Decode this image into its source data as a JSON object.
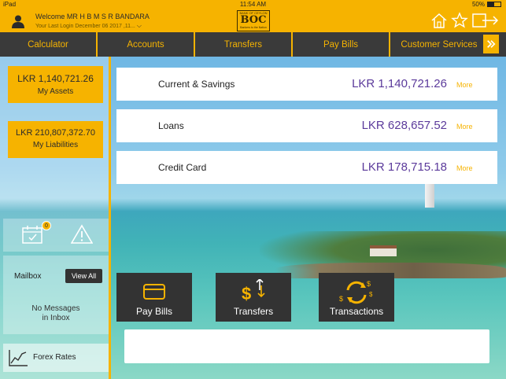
{
  "status_bar": {
    "device": "iPad",
    "time": "11:54 AM",
    "battery": "50%"
  },
  "header": {
    "welcome": "Welcome MR H B M S R BANDARA",
    "last_login": "Your Last Login December 06 2017 ,11...",
    "logo": {
      "top_text": "BANK OF CEYLON",
      "mark": "BOC",
      "tagline": "Bankers to the Nation"
    },
    "icons": [
      "home-icon",
      "favorite-icon",
      "logout-icon"
    ]
  },
  "nav": {
    "items": [
      {
        "label": "Calculator"
      },
      {
        "label": "Accounts"
      },
      {
        "label": "Transfers"
      },
      {
        "label": "Pay Bills"
      },
      {
        "label": "Customer Services"
      }
    ]
  },
  "sidebar": {
    "assets": {
      "value": "LKR 1,140,721.26",
      "label": "My Assets"
    },
    "liabilities": {
      "value": "LKR 210,807,372.70",
      "label": "My Liabilities"
    },
    "calendar_badge": "0",
    "mailbox": {
      "title": "Mailbox",
      "view_all": "View All",
      "empty_line1": "No Messages",
      "empty_line2": "in Inbox"
    },
    "forex": "Forex Rates"
  },
  "accounts": [
    {
      "name": "Current & Savings",
      "amount": "LKR 1,140,721.26",
      "more": "More"
    },
    {
      "name": "Loans",
      "amount": "LKR 628,657.52",
      "more": "More"
    },
    {
      "name": "Credit Card",
      "amount": "LKR 178,715.18",
      "more": "More"
    }
  ],
  "quick_actions": [
    {
      "label": "Pay Bills",
      "icon": "credit-card-icon"
    },
    {
      "label": "Transfers",
      "icon": "transfer-dollar-icon"
    },
    {
      "label": "Transactions",
      "icon": "transactions-cycle-icon"
    }
  ],
  "colors": {
    "accent": "#f6b300",
    "dark": "#333333",
    "amount": "#5b3a9b"
  }
}
